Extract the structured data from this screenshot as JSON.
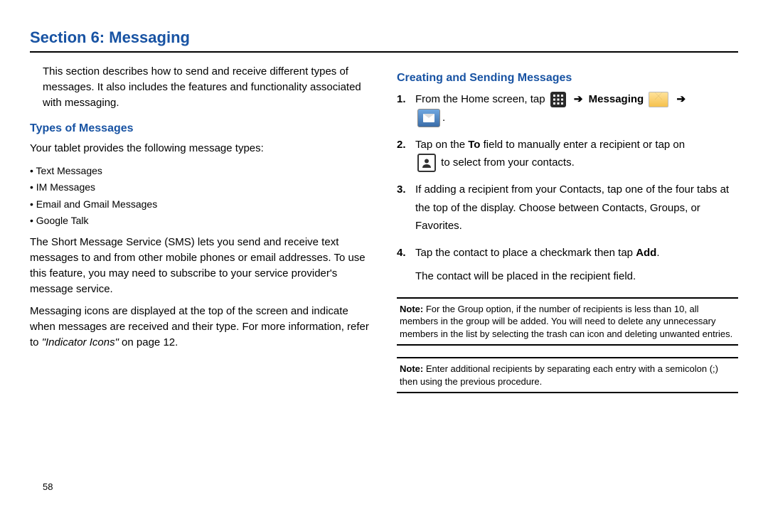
{
  "section_title": "Section 6: Messaging",
  "page_number": "58",
  "left": {
    "intro": "This section describes how to send and receive different types of messages. It also includes the features and functionality associated with messaging.",
    "heading": "Types of Messages",
    "intro2": "Your tablet provides the following message types:",
    "bullets": [
      "Text Messages",
      "IM Messages",
      "Email and Gmail Messages",
      "Google Talk"
    ],
    "para1": "The Short Message Service (SMS) lets you send and receive text messages to and from other mobile phones or email addresses. To use this feature, you may need to subscribe to your service provider's message service.",
    "para2_a": "Messaging icons are displayed at the top of the screen and indicate when messages are received and their type. For more information, refer to ",
    "para2_ref": "\"Indicator Icons\"",
    "para2_b": "  on page 12."
  },
  "right": {
    "heading": "Creating and Sending Messages",
    "steps": {
      "s1_a": "From the Home screen, tap ",
      "s1_messaging": "Messaging",
      "s2_a": "Tap on the ",
      "s2_to": "To",
      "s2_b": " field to manually enter a recipient or tap on ",
      "s2_c": " to select from your contacts.",
      "s3": "If adding a recipient from your Contacts, tap one of the four tabs at the top of the display. Choose between Contacts, Groups, or Favorites.",
      "s4_a": "Tap the contact to place a checkmark then tap ",
      "s4_add": "Add",
      "s4_b": ".",
      "s4_c": "The contact will be placed in the recipient field."
    },
    "note1_label": "Note:",
    "note1": " For the Group option, if the number of recipients is less than 10, all members in the group will be added. You will need to delete any unnecessary members in the list by selecting the trash can icon and deleting unwanted entries.",
    "note2_label": "Note:",
    "note2": " Enter additional recipients by separating each entry with a semicolon (;) then using the previous procedure."
  }
}
